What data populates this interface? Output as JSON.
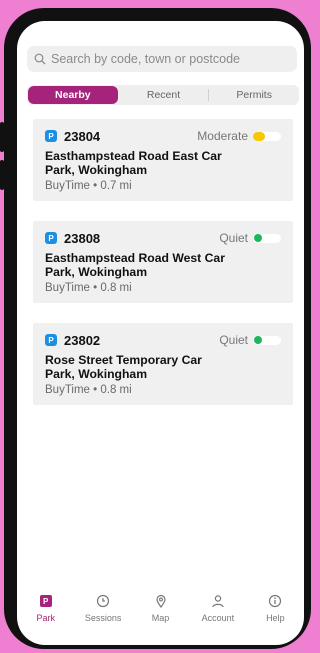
{
  "search": {
    "placeholder": "Search by code, town or postcode"
  },
  "segment_tabs": [
    {
      "label": "Nearby",
      "active": true
    },
    {
      "label": "Recent",
      "active": false
    },
    {
      "label": "Permits",
      "active": false
    }
  ],
  "locations": [
    {
      "badge": "P",
      "code": "23804",
      "status": "Moderate",
      "status_color": "#f6c800",
      "name": "Easthampstead Road East Car Park, Wokingham",
      "detail": "BuyTime • 0.7 mi"
    },
    {
      "badge": "P",
      "code": "23808",
      "status": "Quiet",
      "status_color": "#1bb75a",
      "name": "Easthampstead Road West Car Park, Wokingham",
      "detail": "BuyTime • 0.8 mi"
    },
    {
      "badge": "P",
      "code": "23802",
      "status": "Quiet",
      "status_color": "#1bb75a",
      "name": "Rose Street Temporary Car Park, Wokingham",
      "detail": "BuyTime • 0.8 mi"
    }
  ],
  "bottom_nav": [
    {
      "label": "Park",
      "icon": "park-p-icon",
      "active": true
    },
    {
      "label": "Sessions",
      "icon": "clock-icon",
      "active": false
    },
    {
      "label": "Map",
      "icon": "map-pin-icon",
      "active": false
    },
    {
      "label": "Account",
      "icon": "person-icon",
      "active": false
    },
    {
      "label": "Help",
      "icon": "info-icon",
      "active": false
    }
  ],
  "colors": {
    "accent": "#a5237a",
    "badge_blue": "#1a8fe3",
    "background": "#ef7fd0"
  }
}
